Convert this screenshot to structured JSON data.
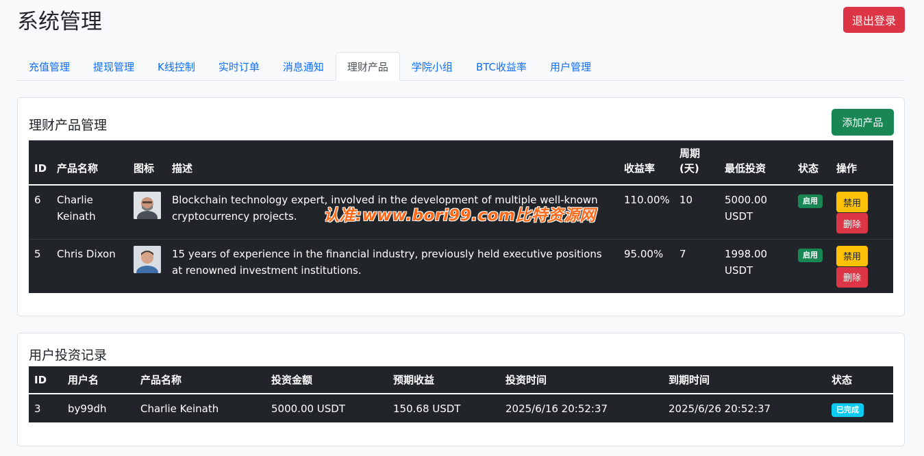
{
  "header": {
    "title": "系统管理",
    "logout_label": "退出登录"
  },
  "tabs": [
    {
      "label": "充值管理",
      "active": false
    },
    {
      "label": "提现管理",
      "active": false
    },
    {
      "label": "K线控制",
      "active": false
    },
    {
      "label": "实时订单",
      "active": false
    },
    {
      "label": "消息通知",
      "active": false
    },
    {
      "label": "理财产品",
      "active": true
    },
    {
      "label": "学院小组",
      "active": false
    },
    {
      "label": "BTC收益率",
      "active": false
    },
    {
      "label": "用户管理",
      "active": false
    }
  ],
  "products": {
    "title": "理财产品管理",
    "add_label": "添加产品",
    "columns": {
      "id": "ID",
      "name": "产品名称",
      "icon": "图标",
      "desc": "描述",
      "rate": "收益率",
      "period": "周期(天)",
      "min": "最低投资",
      "status": "状态",
      "actions": "操作"
    },
    "rows": [
      {
        "id": "6",
        "name": "Charlie Keinath",
        "icon": "avatar-photo",
        "desc": "Blockchain technology expert, involved in the development of multiple well-known cryptocurrency projects.",
        "rate": "110.00%",
        "period": "10",
        "min": "5000.00 USDT",
        "status": "启用",
        "disable_label": "禁用",
        "delete_label": "删除"
      },
      {
        "id": "5",
        "name": "Chris Dixon",
        "icon": "avatar-photo",
        "desc": "15 years of experience in the financial industry, previously held executive positions at renowned investment institutions.",
        "rate": "95.00%",
        "period": "7",
        "min": "1998.00 USDT",
        "status": "启用",
        "disable_label": "禁用",
        "delete_label": "删除"
      }
    ]
  },
  "investments": {
    "title": "用户投资记录",
    "columns": {
      "id": "ID",
      "user": "用户名",
      "product": "产品名称",
      "amount": "投资金额",
      "expected": "预期收益",
      "time": "投资时间",
      "due": "到期时间",
      "status": "状态"
    },
    "rows": [
      {
        "id": "3",
        "user": "by99dh",
        "product": "Charlie Keinath",
        "amount": "5000.00 USDT",
        "expected": "150.68 USDT",
        "time": "2025/6/16 20:52:37",
        "due": "2025/6/26 20:52:37",
        "status": "已完成"
      }
    ]
  },
  "watermark": "认准:www.bori99.com比特资源网",
  "colors": {
    "primary": "#0d6efd",
    "danger": "#dc3545",
    "success": "#198754",
    "warning": "#ffc107",
    "info": "#0dcaf0",
    "dark": "#212529"
  }
}
